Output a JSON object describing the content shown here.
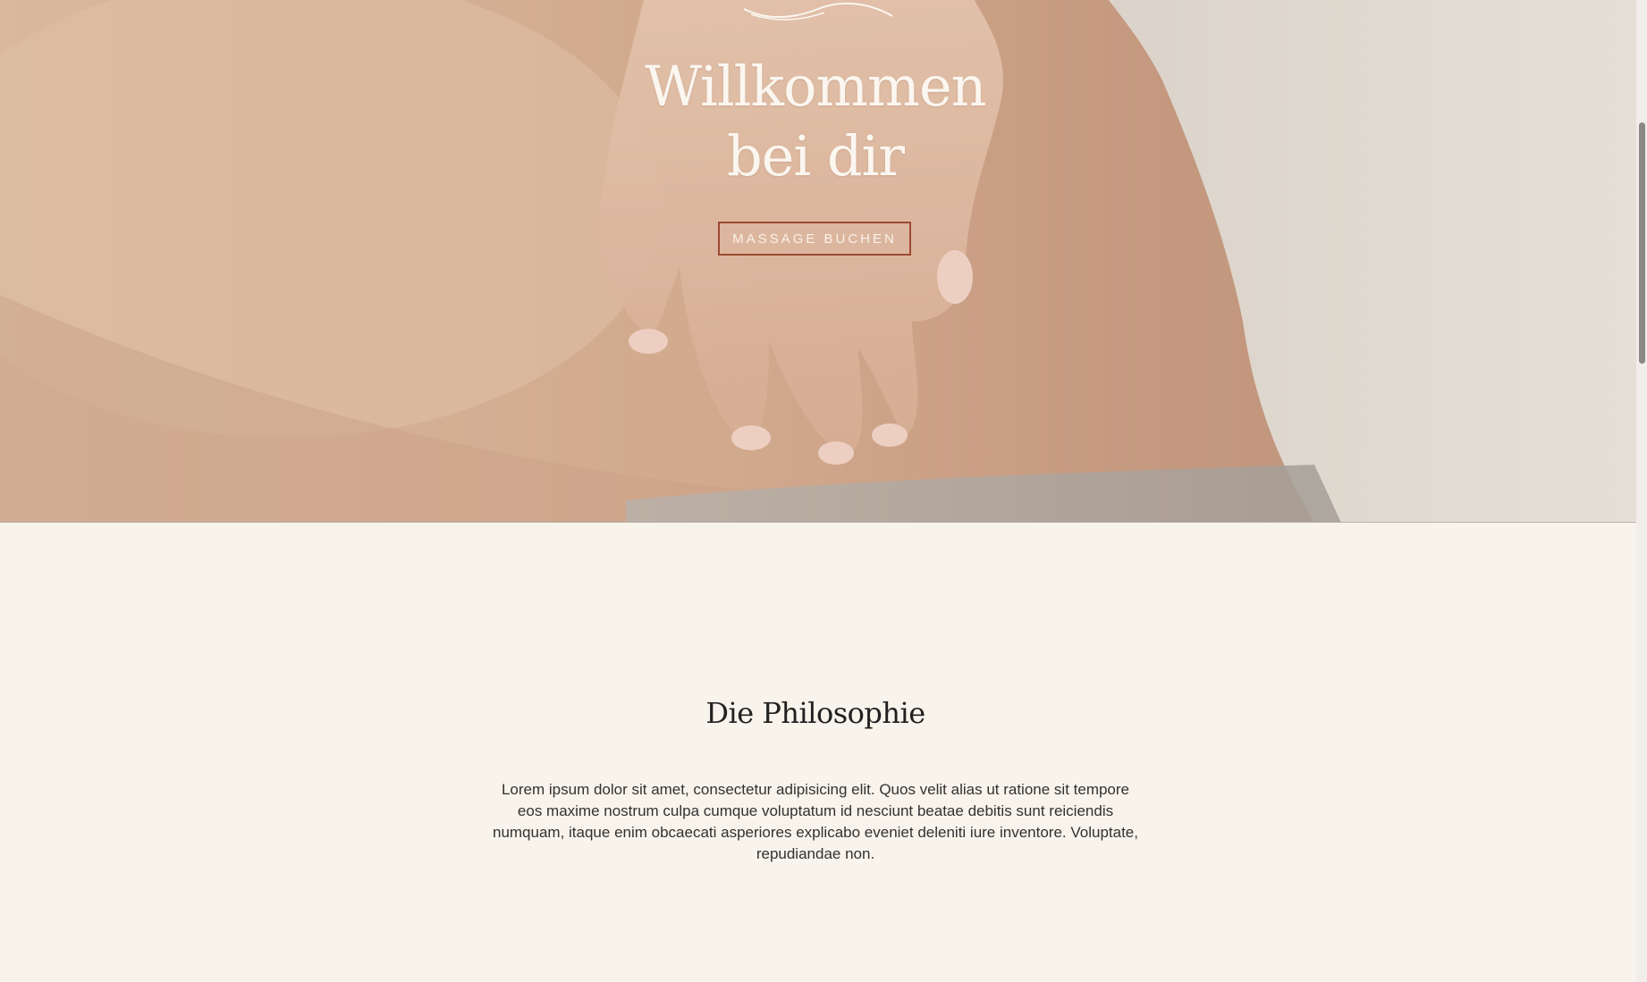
{
  "hero": {
    "title_line1": "Willkommen",
    "title_line2": "bei dir",
    "button_label": "MASSAGE BUCHEN",
    "logo_icon": "wave-logo-icon",
    "button_border_color": "#9e4a33"
  },
  "philosophy": {
    "title": "Die Philosophie",
    "text": "Lorem ipsum dolor sit amet, consectetur adipisicing elit. Quos velit alias ut ratione sit tempore eos maxime nostrum culpa cumque voluptatum id nesciunt beatae debitis sunt reiciendis numquam, itaque enim obcaecati asperiores explicabo eveniet deleniti iure inventore. Voluptate, repudiandae non."
  },
  "colors": {
    "background": "#f8f4ec",
    "text": "#222120",
    "accent": "#9e4a33"
  }
}
